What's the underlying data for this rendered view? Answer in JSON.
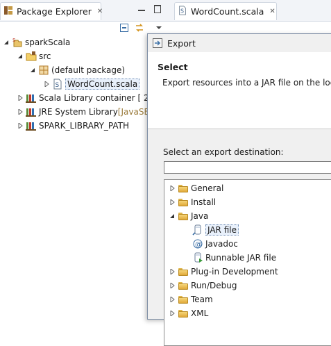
{
  "package_explorer": {
    "tab_label": "Package Explorer",
    "tree": [
      {
        "label": "sparkScala",
        "suffix": ""
      },
      {
        "label": "src",
        "suffix": ""
      },
      {
        "label": "(default package)",
        "suffix": ""
      },
      {
        "label": "WordCount.scala",
        "suffix": ""
      },
      {
        "label": "Scala Library container [ 2.",
        "suffix": ""
      },
      {
        "label": "JRE System Library ",
        "suffix": "[JavaSE"
      },
      {
        "label": "SPARK_LIBRARY_PATH",
        "suffix": ""
      }
    ]
  },
  "editor": {
    "tab_label": "WordCount.scala"
  },
  "dialog": {
    "title": "Export",
    "heading": "Select",
    "description": "Export resources into a JAR file on the loc",
    "destination_label": "Select an export destination:",
    "filter_value": "",
    "tree": [
      {
        "label": "General"
      },
      {
        "label": "Install"
      },
      {
        "label": "Java"
      },
      {
        "label": "JAR file"
      },
      {
        "label": "Javadoc"
      },
      {
        "label": "Runnable JAR file"
      },
      {
        "label": "Plug-in Development"
      },
      {
        "label": "Run/Debug"
      },
      {
        "label": "Team"
      },
      {
        "label": "XML"
      }
    ]
  }
}
